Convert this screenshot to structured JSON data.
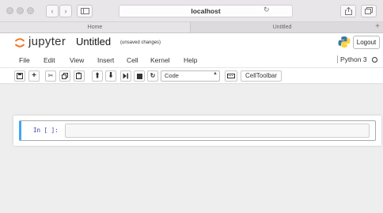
{
  "browser": {
    "address": "localhost",
    "tabs": [
      "Home",
      "Untitled"
    ],
    "new_tab": "+"
  },
  "header": {
    "logo_word": "jupyter",
    "notebook_name": "Untitled",
    "unsaved": "(unsaved changes)",
    "logout": "Logout"
  },
  "menu": {
    "items": [
      "File",
      "Edit",
      "View",
      "Insert",
      "Cell",
      "Kernel",
      "Help"
    ],
    "kernel": "Python 3"
  },
  "toolbar": {
    "cell_type": "Code",
    "celltoolbar": "CellToolbar"
  },
  "cell": {
    "prompt": "In [ ]:"
  }
}
